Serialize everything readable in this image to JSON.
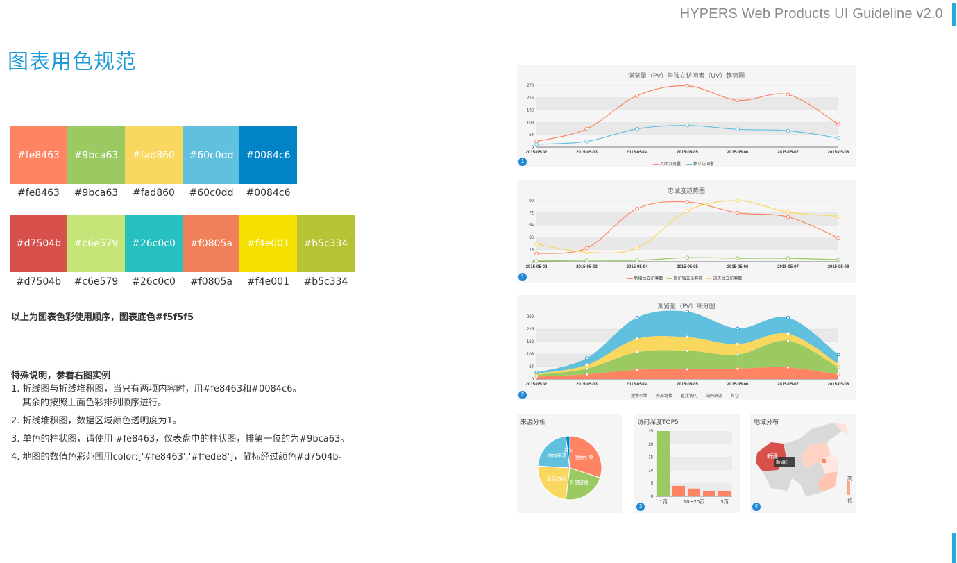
{
  "header": {
    "title": "HYPERS Web Products UI Guideline v2.0"
  },
  "page_title": "图表用色规范",
  "palette_row1": [
    {
      "label": "#fe8463",
      "color": "#fe8463"
    },
    {
      "label": "#9bca63",
      "color": "#9bca63"
    },
    {
      "label": "#fad860",
      "color": "#fad860"
    },
    {
      "label": "#60c0dd",
      "color": "#60c0dd"
    },
    {
      "label": "#0084c6",
      "color": "#0084c6"
    }
  ],
  "palette_row2": [
    {
      "label": "#d7504b",
      "color": "#d7504b"
    },
    {
      "label": "#c6e579",
      "color": "#c6e579"
    },
    {
      "label": "#26c0c0",
      "color": "#26c0c0"
    },
    {
      "label": "#f0805a",
      "color": "#f0805a"
    },
    {
      "label": "#f4e001",
      "color": "#f4e001"
    },
    {
      "label": "#b5c334",
      "color": "#b5c334"
    }
  ],
  "order_note": "以上为图表色彩使用顺序，图表底色#f5f5f5",
  "special": {
    "heading": "特殊说明，参看右图实例",
    "item1": "1. 折线图与折线堆积图，当只有两项内容时，用#fe8463和#0084c6。",
    "item1b": "其余的按照上面色彩排列顺序进行。",
    "item2": "2. 折线堆积图，数据区域颜色透明度为1。",
    "item3": "3. 单色的柱状图，请使用 #fe8463，仪表盘中的柱状图，排第一位的为#9bca63。",
    "item4": "4. 地图的数值色彩范围用color:['#fe8463','#ffede8']，鼠标经过颜色#d7504b。"
  },
  "colors": {
    "chart_bg": "#f5f5f5",
    "accent": "#1e9ad6"
  },
  "chart_data": [
    {
      "type": "line",
      "title": "浏览量（PV）与独立访问者（UV）趋势图",
      "badge": "1",
      "x": [
        "2015-05-02",
        "2015-05-03",
        "2015-05-04",
        "2015-05-05",
        "2015-05-06",
        "2015-05-07",
        "2015-05-08"
      ],
      "yticks": [
        "0",
        "54",
        "108",
        "162",
        "216",
        "270"
      ],
      "ylim": [
        0,
        270
      ],
      "series": [
        {
          "name": "页面浏览量",
          "color": "#fe8463",
          "values": [
            25,
            80,
            225,
            268,
            205,
            230,
            100
          ]
        },
        {
          "name": "独立访问者",
          "color": "#60c0dd",
          "values": [
            12,
            25,
            80,
            95,
            78,
            72,
            40
          ]
        }
      ]
    },
    {
      "type": "line",
      "title": "忠诚度趋势图",
      "badge": "1",
      "x": [
        "2015-05-02",
        "2015-05-03",
        "2015-05-04",
        "2015-05-05",
        "2015-05-06",
        "2015-05-07",
        "2015-05-08"
      ],
      "yticks": [
        "0",
        "18",
        "36",
        "54",
        "72",
        "90"
      ],
      "ylim": [
        0,
        90
      ],
      "series": [
        {
          "name": "新增独立访客数",
          "color": "#fe8463",
          "values": [
            12,
            20,
            78,
            88,
            72,
            66,
            35
          ]
        },
        {
          "name": "回访独立访客数",
          "color": "#9bca63",
          "values": [
            1,
            2,
            2,
            6,
            5,
            5,
            3
          ]
        },
        {
          "name": "流失独立访客数",
          "color": "#fad860",
          "values": [
            26,
            14,
            20,
            75,
            90,
            73,
            67
          ]
        }
      ]
    },
    {
      "type": "area",
      "title": "浏览量（PV）细分图",
      "badge": "2",
      "x": [
        "2015-05-02",
        "2015-05-03",
        "2015-05-04",
        "2015-05-05",
        "2015-05-06",
        "2015-05-07",
        "2015-05-08"
      ],
      "yticks": [
        "0",
        "54",
        "108",
        "162",
        "215",
        "269"
      ],
      "ylim": [
        0,
        269
      ],
      "stacked": true,
      "series": [
        {
          "name": "搜索引擎",
          "color": "#fe8463",
          "values": [
            10,
            20,
            40,
            42,
            45,
            50,
            20
          ]
        },
        {
          "name": "外部链接",
          "color": "#9bca63",
          "values": [
            8,
            25,
            75,
            80,
            60,
            115,
            30
          ]
        },
        {
          "name": "直接访问",
          "color": "#fad860",
          "values": [
            5,
            15,
            58,
            58,
            45,
            30,
            15
          ]
        },
        {
          "name": "站内来源",
          "color": "#60c0dd",
          "values": [
            5,
            30,
            92,
            110,
            68,
            70,
            40
          ]
        },
        {
          "name": "其它",
          "color": "#0084c6",
          "values": [
            0,
            0,
            0,
            0,
            0,
            0,
            0
          ]
        }
      ]
    },
    {
      "type": "pie",
      "title": "来源分析",
      "badge": "",
      "slices": [
        {
          "name": "搜索引擎",
          "color": "#fe8463",
          "value": 30
        },
        {
          "name": "外部链接",
          "color": "#9bca63",
          "value": 22
        },
        {
          "name": "直接访问",
          "color": "#fad860",
          "value": 24
        },
        {
          "name": "站内来源",
          "color": "#60c0dd",
          "value": 22
        },
        {
          "name": "其它",
          "color": "#0084c6",
          "value": 2
        }
      ]
    },
    {
      "type": "bar",
      "title": "访问深度TOP5",
      "badge": "3",
      "categories": [
        "1页",
        "",
        "10~20页",
        "",
        "3页"
      ],
      "xtick_labels": [
        "1页",
        "10~20页",
        "3页"
      ],
      "yticks": [
        "0",
        "5",
        "10",
        "15",
        "20",
        "25"
      ],
      "ylim": [
        0,
        25
      ],
      "values": [
        26,
        4,
        3,
        2,
        2
      ],
      "colors": [
        "#9bca63",
        "#fe8463",
        "#fe8463",
        "#fe8463",
        "#fe8463"
      ]
    },
    {
      "type": "map",
      "title": "地域分布",
      "badge": "4",
      "hover_region": "新疆",
      "tooltip": "新疆：-",
      "scale_high": "高",
      "scale_low": "低",
      "colors": {
        "hover": "#d7504b",
        "high": "#fe8463",
        "low": "#ffede8",
        "empty": "#d9d9d9"
      }
    }
  ]
}
